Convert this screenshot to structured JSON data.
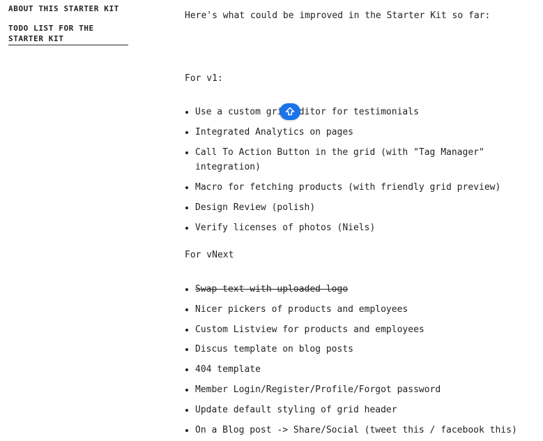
{
  "sidebar": {
    "items": [
      {
        "label": "About this Starter Kit",
        "active": false
      },
      {
        "label": "Todo list for the Starter Kit",
        "active": true
      }
    ]
  },
  "main": {
    "intro": "Here's what could be improved in the Starter Kit so far:",
    "sections": [
      {
        "heading": "For v1:",
        "items": [
          {
            "text": "Use a custom grid editor for testimonials",
            "done": false
          },
          {
            "text": "Integrated Analytics on pages",
            "done": false
          },
          {
            "text": "Call To Action Button in the grid (with \"Tag Manager\" integration)",
            "done": false
          },
          {
            "text": "Macro for fetching products (with friendly grid preview)",
            "done": false
          },
          {
            "text": "Design Review (polish)",
            "done": false
          },
          {
            "text": "Verify licenses of photos (Niels)",
            "done": false
          }
        ]
      },
      {
        "heading": "For vNext",
        "items": [
          {
            "text": "Swap text with uploaded logo",
            "done": true
          },
          {
            "text": "Nicer pickers of products and employees",
            "done": false
          },
          {
            "text": "Custom Listview for products and employees",
            "done": false
          },
          {
            "text": "Discus template on blog posts",
            "done": false
          },
          {
            "text": "404 template",
            "done": false
          },
          {
            "text": "Member Login/Register/Profile/Forgot password",
            "done": false
          },
          {
            "text": "Update default styling of grid header",
            "done": false
          },
          {
            "text": "On a Blog post -> Share/Social (tweet this / facebook this)",
            "done": false
          }
        ]
      }
    ]
  },
  "overlay": {
    "icon": "shift-up-icon",
    "color": "#1a73e8"
  }
}
